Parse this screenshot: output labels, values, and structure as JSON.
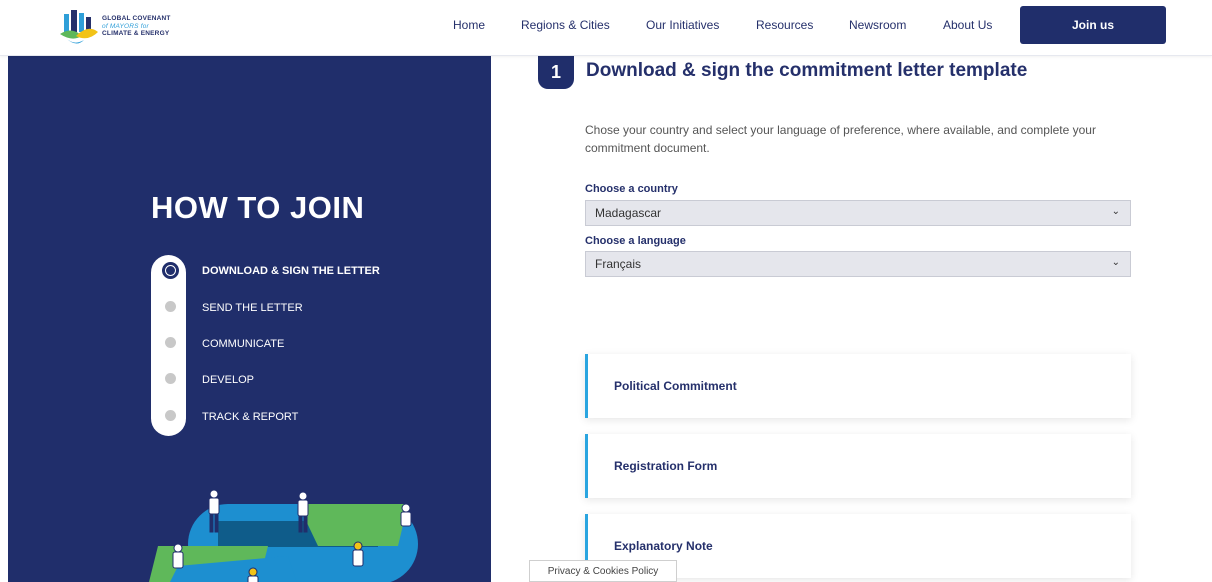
{
  "header": {
    "logo_lines": [
      "GLOBAL COVENANT",
      "of MAYORS for",
      "CLIMATE & ENERGY"
    ],
    "nav": [
      {
        "label": "Home"
      },
      {
        "label": "Regions & Cities"
      },
      {
        "label": "Our Initiatives"
      },
      {
        "label": "Resources"
      },
      {
        "label": "Newsroom"
      },
      {
        "label": "About Us"
      }
    ],
    "join_label": "Join us"
  },
  "sidebar": {
    "title": "HOW TO JOIN",
    "steps": [
      {
        "label": "DOWNLOAD & SIGN THE LETTER",
        "active": true
      },
      {
        "label": "SEND THE LETTER",
        "active": false
      },
      {
        "label": "COMMUNICATE",
        "active": false
      },
      {
        "label": "DEVELOP",
        "active": false
      },
      {
        "label": "TRACK & REPORT",
        "active": false
      }
    ]
  },
  "main": {
    "step_number": "1",
    "title": "Download & sign the commitment letter template",
    "intro": "Chose your country and select your language of preference, where available, and complete your commitment document.",
    "country": {
      "label": "Choose a country",
      "value": "Madagascar"
    },
    "language": {
      "label": "Choose a language",
      "value": "Français"
    },
    "documents": [
      {
        "label": "Political Commitment"
      },
      {
        "label": "Registration Form"
      },
      {
        "label": "Explanatory Note"
      }
    ]
  },
  "footer": {
    "cookie_label": "Privacy & Cookies Policy"
  },
  "colors": {
    "navy": "#202e6b",
    "accent": "#2aa5e0",
    "green": "#5fb85a"
  }
}
